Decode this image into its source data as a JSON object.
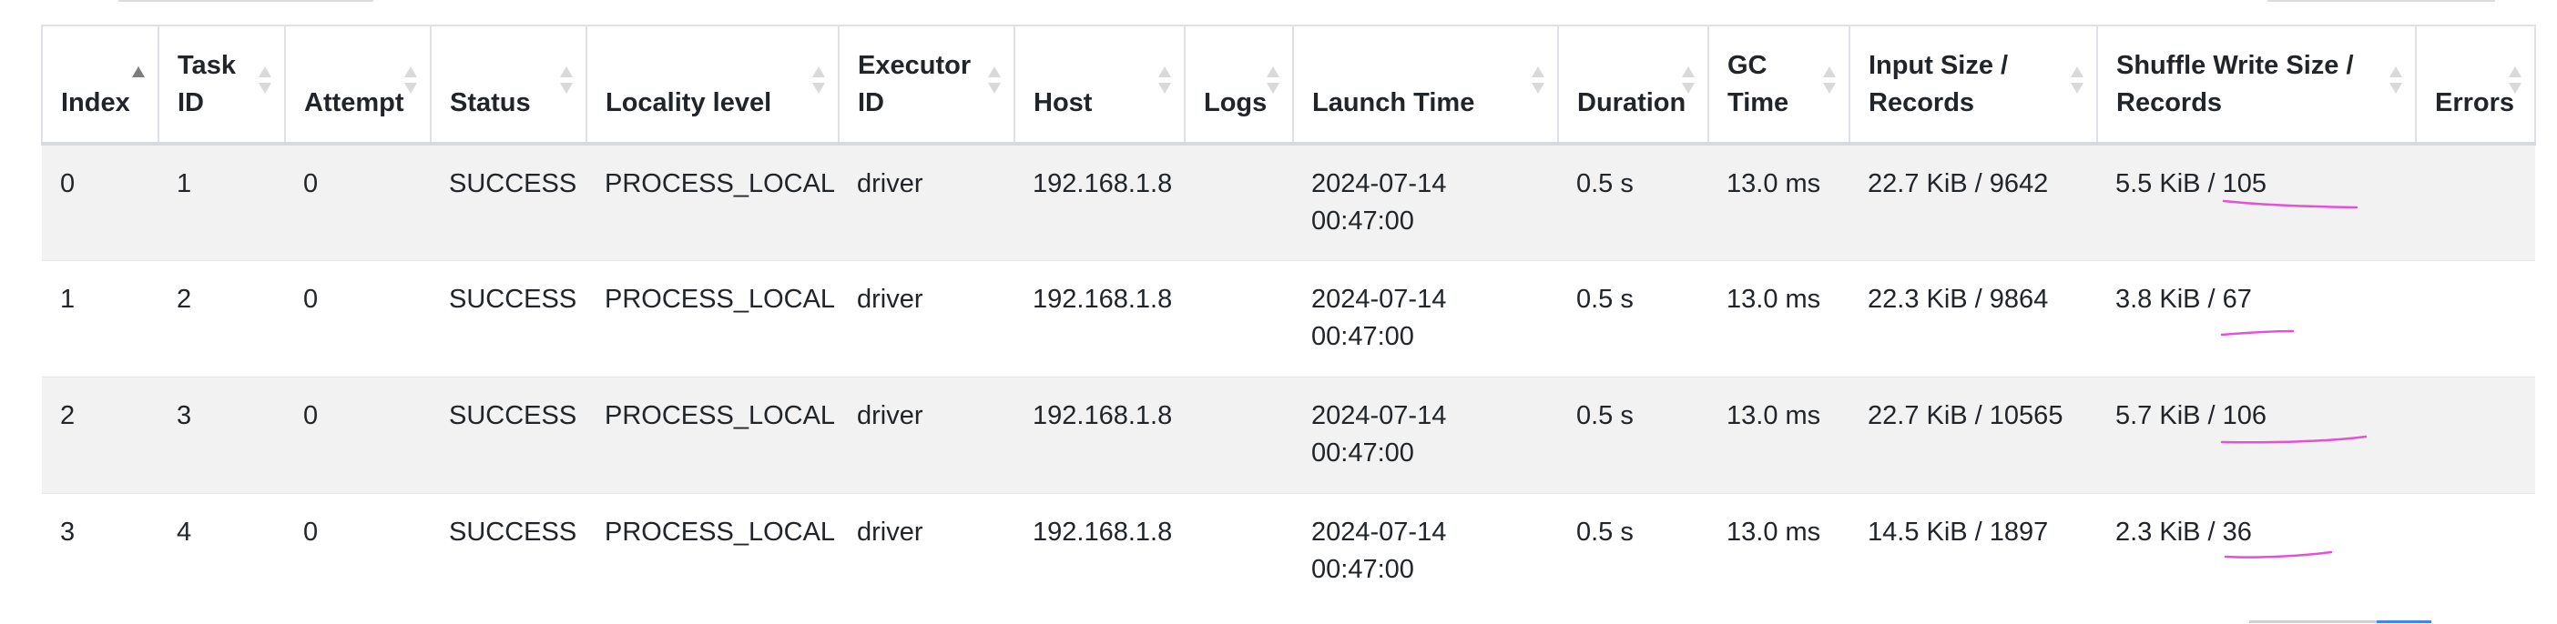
{
  "table": {
    "columns": [
      {
        "key": "index",
        "label": "Index",
        "sorted": true
      },
      {
        "key": "task_id",
        "label": "Task ID"
      },
      {
        "key": "attempt",
        "label": "Attempt"
      },
      {
        "key": "status",
        "label": "Status"
      },
      {
        "key": "locality",
        "label": "Locality level"
      },
      {
        "key": "executor",
        "label": "Executor ID"
      },
      {
        "key": "host",
        "label": "Host"
      },
      {
        "key": "logs",
        "label": "Logs"
      },
      {
        "key": "launch_time",
        "label": "Launch Time"
      },
      {
        "key": "duration",
        "label": "Duration"
      },
      {
        "key": "gc_time",
        "label": "GC Time"
      },
      {
        "key": "input",
        "label": "Input Size / Records"
      },
      {
        "key": "shuffle_write",
        "label": "Shuffle Write Size / Records"
      },
      {
        "key": "errors",
        "label": "Errors"
      }
    ],
    "rows": [
      {
        "index": "0",
        "task_id": "1",
        "attempt": "0",
        "status": "SUCCESS",
        "locality": "PROCESS_LOCAL",
        "executor": "driver",
        "host": "192.168.1.8",
        "logs": "",
        "launch_time": "2024-07-14 00:47:00",
        "duration": "0.5 s",
        "gc_time": "13.0 ms",
        "input": "22.7 KiB / 9642",
        "shuffle_write": "5.5 KiB / 105",
        "errors": ""
      },
      {
        "index": "1",
        "task_id": "2",
        "attempt": "0",
        "status": "SUCCESS",
        "locality": "PROCESS_LOCAL",
        "executor": "driver",
        "host": "192.168.1.8",
        "logs": "",
        "launch_time": "2024-07-14 00:47:00",
        "duration": "0.5 s",
        "gc_time": "13.0 ms",
        "input": "22.3 KiB / 9864",
        "shuffle_write": "3.8 KiB / 67",
        "errors": ""
      },
      {
        "index": "2",
        "task_id": "3",
        "attempt": "0",
        "status": "SUCCESS",
        "locality": "PROCESS_LOCAL",
        "executor": "driver",
        "host": "192.168.1.8",
        "logs": "",
        "launch_time": "2024-07-14 00:47:00",
        "duration": "0.5 s",
        "gc_time": "13.0 ms",
        "input": "22.7 KiB / 10565",
        "shuffle_write": "5.7 KiB / 106",
        "errors": ""
      },
      {
        "index": "3",
        "task_id": "4",
        "attempt": "0",
        "status": "SUCCESS",
        "locality": "PROCESS_LOCAL",
        "executor": "driver",
        "host": "192.168.1.8",
        "logs": "",
        "launch_time": "2024-07-14 00:47:00",
        "duration": "0.5 s",
        "gc_time": "13.0 ms",
        "input": "14.5 KiB / 1897",
        "shuffle_write": "2.3 KiB / 36",
        "errors": ""
      }
    ]
  },
  "colors": {
    "annotation_ink": "#e64fd8",
    "row_stripe": "#f2f2f2",
    "border": "#dee2e6"
  }
}
